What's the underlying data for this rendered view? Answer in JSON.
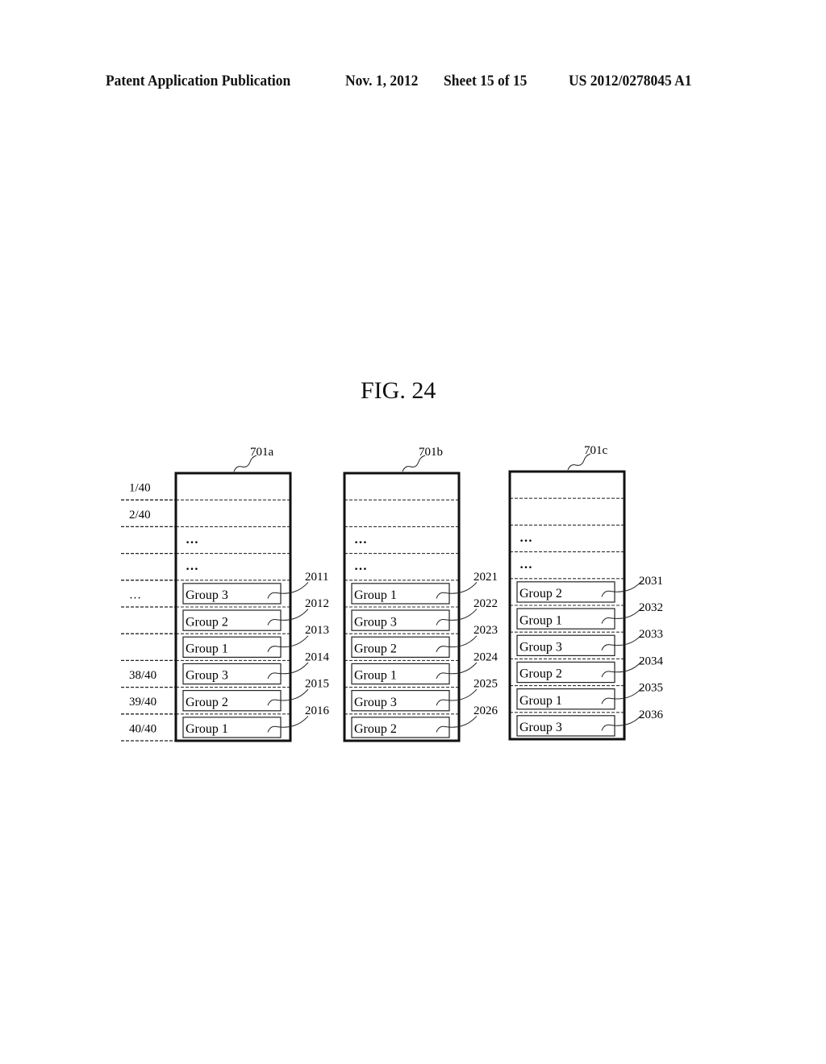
{
  "header": {
    "left": "Patent Application Publication",
    "date": "Nov. 1, 2012",
    "sheet": "Sheet 15 of 15",
    "number": "US 2012/0278045 A1"
  },
  "figure": {
    "title": "FIG. 24",
    "row_labels": [
      "1/40",
      "2/40",
      "",
      "",
      "…",
      "",
      "",
      "38/40",
      "39/40",
      "40/40"
    ],
    "ellipsis": "…",
    "columns": [
      {
        "ref": "701a",
        "slots": [
          {
            "label": "Group 3",
            "ref": "2011"
          },
          {
            "label": "Group 2",
            "ref": "2012"
          },
          {
            "label": "Group 1",
            "ref": "2013"
          },
          {
            "label": "Group 3",
            "ref": "2014"
          },
          {
            "label": "Group 2",
            "ref": "2015"
          },
          {
            "label": "Group 1",
            "ref": "2016"
          }
        ]
      },
      {
        "ref": "701b",
        "slots": [
          {
            "label": "Group 1",
            "ref": "2021"
          },
          {
            "label": "Group 3",
            "ref": "2022"
          },
          {
            "label": "Group 2",
            "ref": "2023"
          },
          {
            "label": "Group 1",
            "ref": "2024"
          },
          {
            "label": "Group 3",
            "ref": "2025"
          },
          {
            "label": "Group 2",
            "ref": "2026"
          }
        ]
      },
      {
        "ref": "701c",
        "slots": [
          {
            "label": "Group 2",
            "ref": "2031"
          },
          {
            "label": "Group 1",
            "ref": "2032"
          },
          {
            "label": "Group 3",
            "ref": "2033"
          },
          {
            "label": "Group 2",
            "ref": "2034"
          },
          {
            "label": "Group 1",
            "ref": "2035"
          },
          {
            "label": "Group 3",
            "ref": "2036"
          }
        ]
      }
    ]
  }
}
